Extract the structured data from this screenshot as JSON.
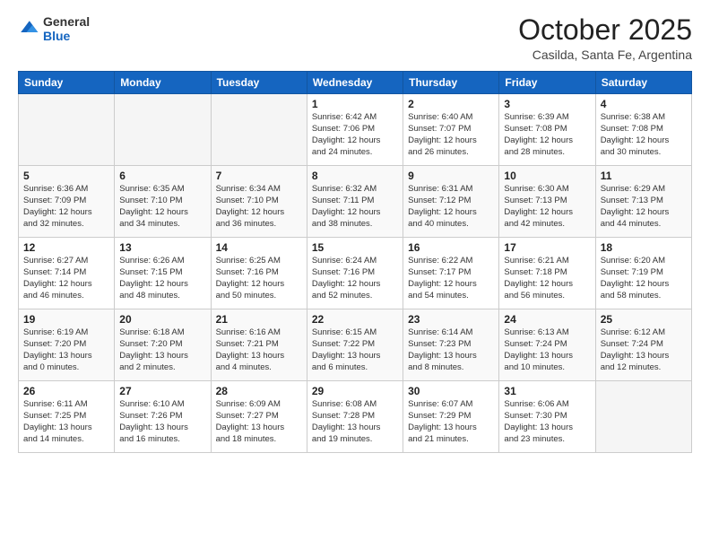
{
  "logo": {
    "general": "General",
    "blue": "Blue"
  },
  "header": {
    "month": "October 2025",
    "location": "Casilda, Santa Fe, Argentina"
  },
  "weekdays": [
    "Sunday",
    "Monday",
    "Tuesday",
    "Wednesday",
    "Thursday",
    "Friday",
    "Saturday"
  ],
  "weeks": [
    [
      {
        "day": "",
        "info": ""
      },
      {
        "day": "",
        "info": ""
      },
      {
        "day": "",
        "info": ""
      },
      {
        "day": "1",
        "info": "Sunrise: 6:42 AM\nSunset: 7:06 PM\nDaylight: 12 hours\nand 24 minutes."
      },
      {
        "day": "2",
        "info": "Sunrise: 6:40 AM\nSunset: 7:07 PM\nDaylight: 12 hours\nand 26 minutes."
      },
      {
        "day": "3",
        "info": "Sunrise: 6:39 AM\nSunset: 7:08 PM\nDaylight: 12 hours\nand 28 minutes."
      },
      {
        "day": "4",
        "info": "Sunrise: 6:38 AM\nSunset: 7:08 PM\nDaylight: 12 hours\nand 30 minutes."
      }
    ],
    [
      {
        "day": "5",
        "info": "Sunrise: 6:36 AM\nSunset: 7:09 PM\nDaylight: 12 hours\nand 32 minutes."
      },
      {
        "day": "6",
        "info": "Sunrise: 6:35 AM\nSunset: 7:10 PM\nDaylight: 12 hours\nand 34 minutes."
      },
      {
        "day": "7",
        "info": "Sunrise: 6:34 AM\nSunset: 7:10 PM\nDaylight: 12 hours\nand 36 minutes."
      },
      {
        "day": "8",
        "info": "Sunrise: 6:32 AM\nSunset: 7:11 PM\nDaylight: 12 hours\nand 38 minutes."
      },
      {
        "day": "9",
        "info": "Sunrise: 6:31 AM\nSunset: 7:12 PM\nDaylight: 12 hours\nand 40 minutes."
      },
      {
        "day": "10",
        "info": "Sunrise: 6:30 AM\nSunset: 7:13 PM\nDaylight: 12 hours\nand 42 minutes."
      },
      {
        "day": "11",
        "info": "Sunrise: 6:29 AM\nSunset: 7:13 PM\nDaylight: 12 hours\nand 44 minutes."
      }
    ],
    [
      {
        "day": "12",
        "info": "Sunrise: 6:27 AM\nSunset: 7:14 PM\nDaylight: 12 hours\nand 46 minutes."
      },
      {
        "day": "13",
        "info": "Sunrise: 6:26 AM\nSunset: 7:15 PM\nDaylight: 12 hours\nand 48 minutes."
      },
      {
        "day": "14",
        "info": "Sunrise: 6:25 AM\nSunset: 7:16 PM\nDaylight: 12 hours\nand 50 minutes."
      },
      {
        "day": "15",
        "info": "Sunrise: 6:24 AM\nSunset: 7:16 PM\nDaylight: 12 hours\nand 52 minutes."
      },
      {
        "day": "16",
        "info": "Sunrise: 6:22 AM\nSunset: 7:17 PM\nDaylight: 12 hours\nand 54 minutes."
      },
      {
        "day": "17",
        "info": "Sunrise: 6:21 AM\nSunset: 7:18 PM\nDaylight: 12 hours\nand 56 minutes."
      },
      {
        "day": "18",
        "info": "Sunrise: 6:20 AM\nSunset: 7:19 PM\nDaylight: 12 hours\nand 58 minutes."
      }
    ],
    [
      {
        "day": "19",
        "info": "Sunrise: 6:19 AM\nSunset: 7:20 PM\nDaylight: 13 hours\nand 0 minutes."
      },
      {
        "day": "20",
        "info": "Sunrise: 6:18 AM\nSunset: 7:20 PM\nDaylight: 13 hours\nand 2 minutes."
      },
      {
        "day": "21",
        "info": "Sunrise: 6:16 AM\nSunset: 7:21 PM\nDaylight: 13 hours\nand 4 minutes."
      },
      {
        "day": "22",
        "info": "Sunrise: 6:15 AM\nSunset: 7:22 PM\nDaylight: 13 hours\nand 6 minutes."
      },
      {
        "day": "23",
        "info": "Sunrise: 6:14 AM\nSunset: 7:23 PM\nDaylight: 13 hours\nand 8 minutes."
      },
      {
        "day": "24",
        "info": "Sunrise: 6:13 AM\nSunset: 7:24 PM\nDaylight: 13 hours\nand 10 minutes."
      },
      {
        "day": "25",
        "info": "Sunrise: 6:12 AM\nSunset: 7:24 PM\nDaylight: 13 hours\nand 12 minutes."
      }
    ],
    [
      {
        "day": "26",
        "info": "Sunrise: 6:11 AM\nSunset: 7:25 PM\nDaylight: 13 hours\nand 14 minutes."
      },
      {
        "day": "27",
        "info": "Sunrise: 6:10 AM\nSunset: 7:26 PM\nDaylight: 13 hours\nand 16 minutes."
      },
      {
        "day": "28",
        "info": "Sunrise: 6:09 AM\nSunset: 7:27 PM\nDaylight: 13 hours\nand 18 minutes."
      },
      {
        "day": "29",
        "info": "Sunrise: 6:08 AM\nSunset: 7:28 PM\nDaylight: 13 hours\nand 19 minutes."
      },
      {
        "day": "30",
        "info": "Sunrise: 6:07 AM\nSunset: 7:29 PM\nDaylight: 13 hours\nand 21 minutes."
      },
      {
        "day": "31",
        "info": "Sunrise: 6:06 AM\nSunset: 7:30 PM\nDaylight: 13 hours\nand 23 minutes."
      },
      {
        "day": "",
        "info": ""
      }
    ]
  ]
}
